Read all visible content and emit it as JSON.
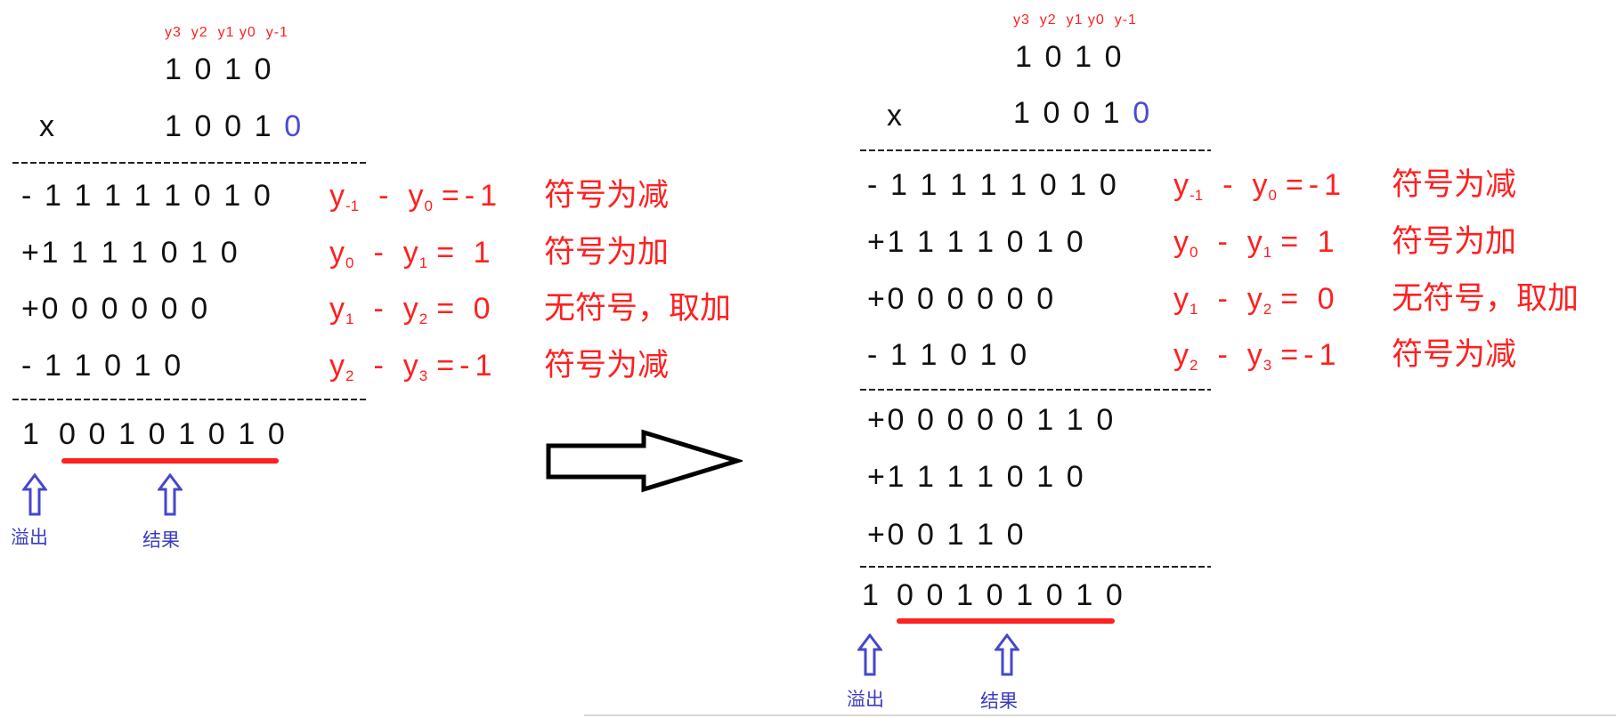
{
  "left": {
    "header": "y3  y2  y1 y0  y-1",
    "multiplicand": "1 0 1 0",
    "times": "x",
    "multiplier": "1 0 0 1 ",
    "appended_bit": "0",
    "rows": [
      {
        "value": "- 1 1 1 1 1 0 1 0",
        "ann": {
          "a": "y",
          "as": "-1",
          "op": "-",
          "b": "y",
          "bs": "0",
          "eq": "=-1"
        },
        "note": "符号为减"
      },
      {
        "value": "+1 1 1 1 0 1 0",
        "ann": {
          "a": "y",
          "as": "0",
          "op": "-",
          "b": "y",
          "bs": "1",
          "eq": "= 1"
        },
        "note": "符号为加"
      },
      {
        "value": "+0 0 0 0 0 0",
        "ann": {
          "a": "y",
          "as": "1",
          "op": "-",
          "b": "y",
          "bs": "2",
          "eq": "= 0"
        },
        "note": "无符号，取加"
      },
      {
        "value": "- 1 1 0 1 0",
        "ann": {
          "a": "y",
          "as": "2",
          "op": "-",
          "b": "y",
          "bs": "3",
          "eq": "=-1"
        },
        "note": "符号为减"
      }
    ],
    "overflow_bit": "1",
    "result_bits": "0 0 1 0 1 0 1 0",
    "overflow_label": "溢出",
    "result_label": "结果"
  },
  "right": {
    "header": "y3  y2  y1 y0  y-1",
    "multiplicand": "1 0 1 0",
    "times": "x",
    "multiplier": "1 0 0 1 ",
    "appended_bit": "0",
    "rows": [
      {
        "value": "- 1 1 1 1 1 0 1 0",
        "ann": {
          "a": "y",
          "as": "-1",
          "op": "-",
          "b": "y",
          "bs": "0",
          "eq": "=-1"
        },
        "note": "符号为减"
      },
      {
        "value": "+1 1 1 1 0 1 0",
        "ann": {
          "a": "y",
          "as": "0",
          "op": "-",
          "b": "y",
          "bs": "1",
          "eq": "= 1"
        },
        "note": "符号为加"
      },
      {
        "value": "+0 0 0 0 0 0",
        "ann": {
          "a": "y",
          "as": "1",
          "op": "-",
          "b": "y",
          "bs": "2",
          "eq": "= 0"
        },
        "note": "无符号，取加"
      },
      {
        "value": "- 1 1 0 1 0",
        "ann": {
          "a": "y",
          "as": "2",
          "op": "-",
          "b": "y",
          "bs": "3",
          "eq": "=-1"
        },
        "note": "符号为减"
      }
    ],
    "partial_sums": [
      "+0 0 0 0 0 1 1 0",
      "+1 1 1 1 0 1 0",
      "+0 0 1 1 0"
    ],
    "overflow_bit": "1",
    "result_bits": "0 0 1 0 1 0 1 0",
    "overflow_label": "溢出",
    "result_label": "结果"
  },
  "icons": {
    "transform_arrow": "right-arrow-icon",
    "pointer_arrow": "up-arrow-icon"
  },
  "colors": {
    "annotation": "#ff2020",
    "appended_bit": "#4a4ad6",
    "pointer": "#3b3bbf",
    "underline": "#ff2020"
  }
}
